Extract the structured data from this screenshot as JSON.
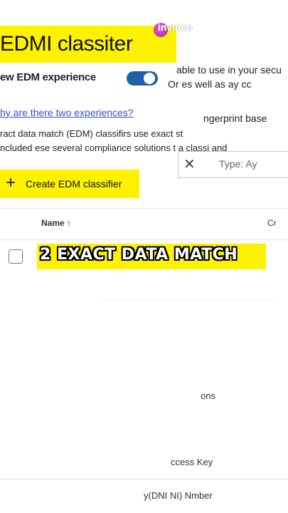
{
  "overlay": {
    "watermark": "invideo"
  },
  "header": {
    "title": "EDMI classiter"
  },
  "experience": {
    "label": "ew EDM experience",
    "right_text": "able to use in your secu",
    "right_text2": "Or   es well as ay cc"
  },
  "info": {
    "link": "hy are there two experiences?",
    "desc_line1": "ract data match (EDM) classifirs use exact st",
    "desc_line2": "ncluded ese several compliance solutions t   a classi     and",
    "fingerprint": "ngerprint base"
  },
  "toolbar": {
    "create_label": "Create EDM classifier",
    "search_placeholder": "Type: Ay"
  },
  "table": {
    "columns": {
      "name": "Name ↑",
      "cr": "Cr"
    },
    "rows": [
      {
        "text": "ons"
      },
      {
        "text": "ccess Key"
      },
      {
        "text": "y(DNI NI) Nmber"
      }
    ]
  },
  "caption": {
    "text": "2 EXACT DATA MATCH"
  },
  "colors": {
    "accent": "#1f5fa8",
    "highlight": "#fff200",
    "link": "#2c52c7"
  }
}
